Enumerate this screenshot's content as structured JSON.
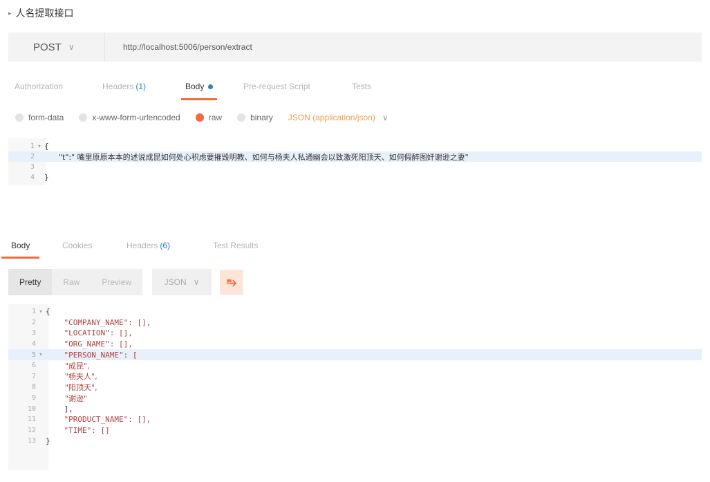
{
  "request_title": "人名提取接口",
  "request": {
    "method": "POST",
    "url": "http://localhost:5006/person/extract"
  },
  "request_tabs": [
    {
      "label": "Authorization",
      "count": "",
      "active": false
    },
    {
      "label": "Headers",
      "count": "(1)",
      "active": false
    },
    {
      "label": "Body",
      "count": "",
      "active": true
    },
    {
      "label": "Pre-request Script",
      "count": "",
      "active": false
    },
    {
      "label": "Tests",
      "count": "",
      "active": false
    }
  ],
  "body_types": [
    {
      "label": "form-data",
      "selected": false
    },
    {
      "label": "x-www-form-urlencoded",
      "selected": false
    },
    {
      "label": "raw",
      "selected": true
    },
    {
      "label": "binary",
      "selected": false
    }
  ],
  "content_type": "JSON (application/json)",
  "request_body": {
    "lines": [
      {
        "num": "1",
        "fold": "▾",
        "text": "{"
      },
      {
        "num": "2",
        "fold": "",
        "text": "      \"t\":\" 嘴里原原本本的述说成昆如何处心积虑要摧毁明教、如何与杨夫人私通幽会以致激死阳顶天、如何假醉图奸谢逊之妻\""
      },
      {
        "num": "3",
        "fold": "",
        "text": ""
      },
      {
        "num": "4",
        "fold": "",
        "text": "}"
      }
    ]
  },
  "response_tabs": [
    {
      "label": "Body",
      "count": "",
      "active": true
    },
    {
      "label": "Cookies",
      "count": "",
      "active": false
    },
    {
      "label": "Headers",
      "count": "(6)",
      "active": false
    },
    {
      "label": "Test Results",
      "count": "",
      "active": false
    }
  ],
  "view_modes": [
    {
      "label": "Pretty",
      "active": true
    },
    {
      "label": "Raw",
      "active": false
    },
    {
      "label": "Preview",
      "active": false
    }
  ],
  "format": "JSON",
  "response_body": {
    "lines": [
      {
        "num": "1",
        "fold": "▾",
        "text": "{"
      },
      {
        "num": "2",
        "fold": "",
        "text": "    \"COMPANY_NAME\": [],"
      },
      {
        "num": "3",
        "fold": "",
        "text": "    \"LOCATION\": [],"
      },
      {
        "num": "4",
        "fold": "",
        "text": "    \"ORG_NAME\": [],"
      },
      {
        "num": "5",
        "fold": "▾",
        "text": "    \"PERSON_NAME\": ["
      },
      {
        "num": "6",
        "fold": "",
        "text": "        \"成昆\","
      },
      {
        "num": "7",
        "fold": "",
        "text": "        \"杨夫人\","
      },
      {
        "num": "8",
        "fold": "",
        "text": "        \"阳顶天\","
      },
      {
        "num": "9",
        "fold": "",
        "text": "        \"谢逊\""
      },
      {
        "num": "10",
        "fold": "",
        "text": "    ],"
      },
      {
        "num": "11",
        "fold": "",
        "text": "    \"PRODUCT_NAME\": [],"
      },
      {
        "num": "12",
        "fold": "",
        "text": "    \"TIME\": []"
      },
      {
        "num": "13",
        "fold": "",
        "text": "}"
      }
    ]
  }
}
